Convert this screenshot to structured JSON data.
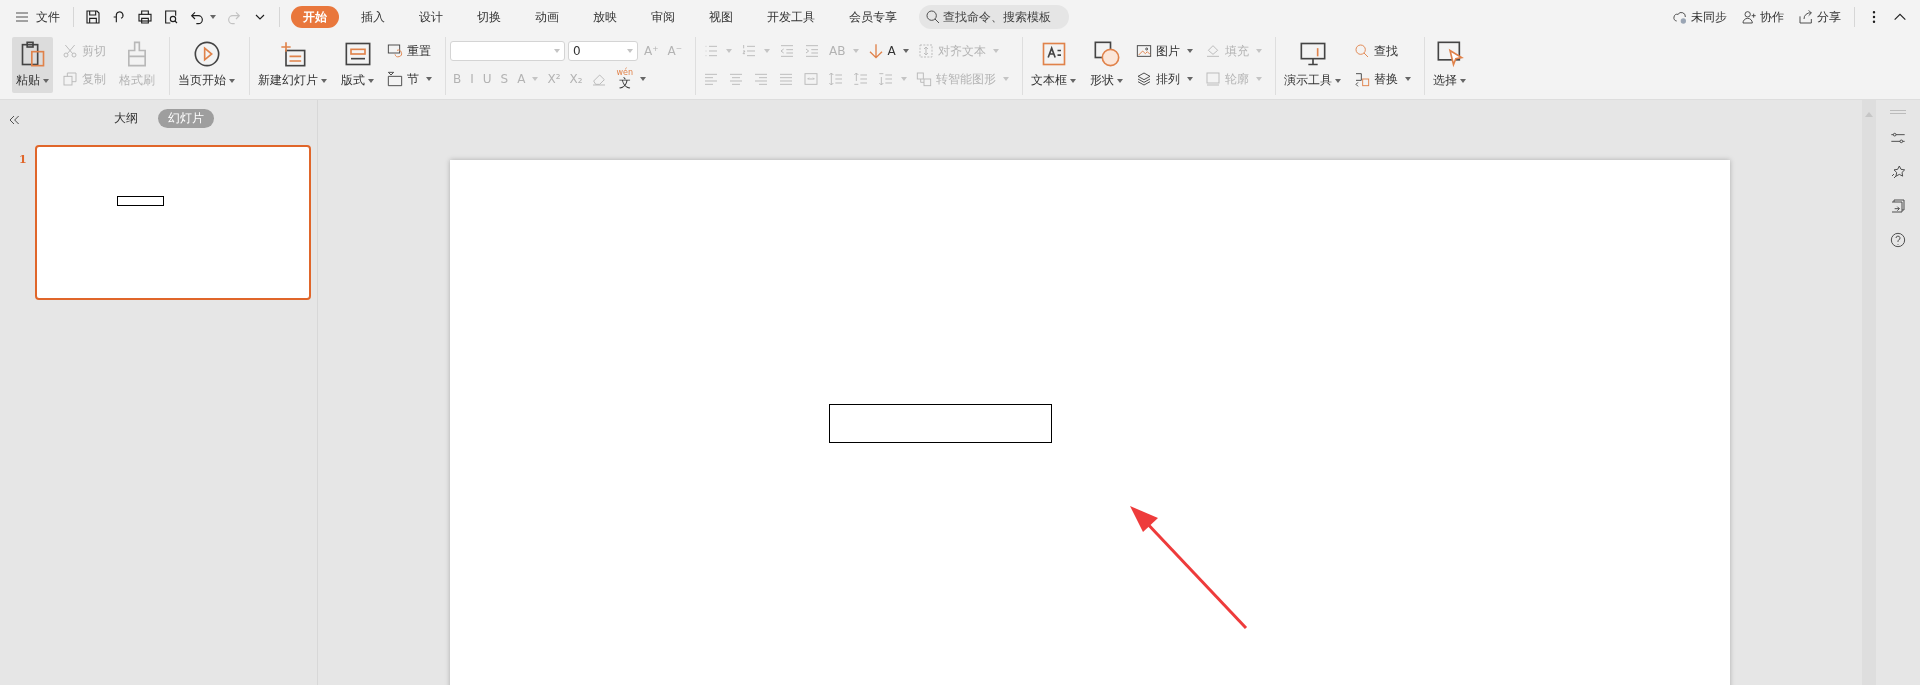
{
  "menu_bar": {
    "file_label": "文件",
    "quick_access": [
      {
        "disabled": false,
        "dropdown": false
      },
      {
        "disabled": false,
        "dropdown": false
      },
      {
        "disabled": false,
        "dropdown": false
      },
      {
        "disabled": false,
        "dropdown": false
      },
      {
        "disabled": false,
        "dropdown": true
      },
      {
        "disabled": true,
        "dropdown": false
      },
      {
        "disabled": false,
        "dropdown": false
      }
    ],
    "tabs": [
      {
        "label": "开始",
        "selected": true
      },
      {
        "label": "插入",
        "selected": false
      },
      {
        "label": "设计",
        "selected": false
      },
      {
        "label": "切换",
        "selected": false
      },
      {
        "label": "动画",
        "selected": false
      },
      {
        "label": "放映",
        "selected": false
      },
      {
        "label": "审阅",
        "selected": false
      },
      {
        "label": "视图",
        "selected": false
      },
      {
        "label": "开发工具",
        "selected": false
      },
      {
        "label": "会员专享",
        "selected": false
      }
    ],
    "search": {
      "placeholder": "查找命令、搜索模板"
    },
    "actions": [
      {
        "label": "未同步"
      },
      {
        "label": "协作"
      },
      {
        "label": "分享"
      }
    ]
  },
  "ribbon": {
    "groups": [
      {
        "columns": [
          {
            "kind": "large",
            "label": "粘贴",
            "dropdown": true,
            "disabled": false,
            "pressed": true
          },
          {
            "kind": "stack",
            "items": [
              {
                "label": "剪切",
                "dropdown": false,
                "disabled": true
              },
              {
                "label": "复制",
                "dropdown": false,
                "disabled": true
              }
            ]
          },
          {
            "kind": "large",
            "label": "格式刷",
            "dropdown": false,
            "disabled": true,
            "pressed": false
          }
        ]
      },
      {
        "columns": [
          {
            "kind": "large",
            "label": "当页开始",
            "dropdown": true,
            "disabled": false,
            "pressed": false
          }
        ]
      },
      {
        "columns": [
          {
            "kind": "large",
            "label": "新建幻灯片",
            "dropdown": true,
            "disabled": false,
            "pressed": false
          },
          {
            "kind": "large",
            "label": "版式",
            "dropdown": true,
            "disabled": false,
            "pressed": false
          },
          {
            "kind": "stack",
            "items": [
              {
                "label": "重置",
                "dropdown": false,
                "disabled": false
              },
              {
                "label": "节",
                "dropdown": true,
                "disabled": false
              }
            ]
          }
        ]
      },
      {
        "upper": [
          {
            "kind": "select",
            "dropdown": true,
            "disabled": true
          },
          {
            "kind": "select",
            "value": "0",
            "dropdown": true,
            "disabled": false
          },
          {
            "label": "A⁺",
            "dropdown": false,
            "disabled": true
          },
          {
            "label": "A⁻",
            "dropdown": false,
            "disabled": true
          }
        ],
        "lower": [
          {
            "label": "B",
            "dropdown": false,
            "disabled": true
          },
          {
            "label": "I",
            "dropdown": false,
            "disabled": true
          },
          {
            "label": "U",
            "dropdown": false,
            "disabled": true
          },
          {
            "label": "S",
            "dropdown": false,
            "disabled": true
          },
          {
            "label": "A",
            "dropdown": true,
            "disabled": true
          },
          {
            "label": "X²",
            "dropdown": false,
            "disabled": true
          },
          {
            "label": "X₂",
            "dropdown": false,
            "disabled": true
          },
          {
            "dropdown": false,
            "disabled": true
          },
          {
            "label": "文",
            "annotation": "wén",
            "dropdown": true,
            "disabled": false
          }
        ]
      },
      {
        "upper": [
          {
            "dropdown": true,
            "disabled": true
          },
          {
            "dropdown": true,
            "disabled": true
          },
          {
            "dropdown": false,
            "disabled": true
          },
          {
            "dropdown": false,
            "disabled": true
          },
          {
            "label": "AB",
            "dropdown": true,
            "disabled": true
          },
          {
            "label": "A",
            "dropdown": true,
            "disabled": false
          },
          {
            "label": "对齐文本",
            "dropdown": true,
            "disabled": true
          }
        ],
        "lower": [
          {
            "dropdown": false,
            "disabled": true
          },
          {
            "dropdown": false,
            "disabled": true
          },
          {
            "dropdown": false,
            "disabled": true
          },
          {
            "dropdown": false,
            "disabled": true
          },
          {
            "dropdown": false,
            "disabled": true
          },
          {
            "dropdown": false,
            "disabled": true
          },
          {
            "dropdown": false,
            "disabled": true
          },
          {
            "dropdown": true,
            "disabled": true
          },
          {
            "label": "转智能图形",
            "dropdown": true,
            "disabled": true
          }
        ]
      },
      {
        "columns": [
          {
            "kind": "large",
            "label": "文本框",
            "dropdown": true,
            "disabled": false,
            "pressed": false
          },
          {
            "kind": "large",
            "label": "形状",
            "dropdown": true,
            "disabled": false,
            "pressed": false
          },
          {
            "kind": "stack",
            "items": [
              {
                "label": "图片",
                "dropdown": true,
                "disabled": false
              },
              {
                "label": "排列",
                "dropdown": true,
                "disabled": false
              }
            ]
          },
          {
            "kind": "stack",
            "items": [
              {
                "label": "填充",
                "dropdown": true,
                "disabled": true
              },
              {
                "label": "轮廓",
                "dropdown": true,
                "disabled": true
              }
            ]
          }
        ]
      },
      {
        "columns": [
          {
            "kind": "large",
            "label": "演示工具",
            "dropdown": true,
            "disabled": false,
            "pressed": false
          },
          {
            "kind": "stack",
            "items": [
              {
                "label": "查找",
                "dropdown": false,
                "disabled": false
              },
              {
                "label": "替换",
                "dropdown": true,
                "disabled": false
              }
            ]
          }
        ]
      },
      {
        "columns": [
          {
            "kind": "large",
            "label": "选择",
            "dropdown": true,
            "disabled": false,
            "pressed": false
          }
        ]
      }
    ]
  },
  "left_panel": {
    "tabs": [
      {
        "label": "大纲",
        "selected": false
      },
      {
        "label": "幻灯片",
        "selected": true
      }
    ],
    "slides": [
      {
        "number": "1",
        "selected": true
      }
    ]
  }
}
